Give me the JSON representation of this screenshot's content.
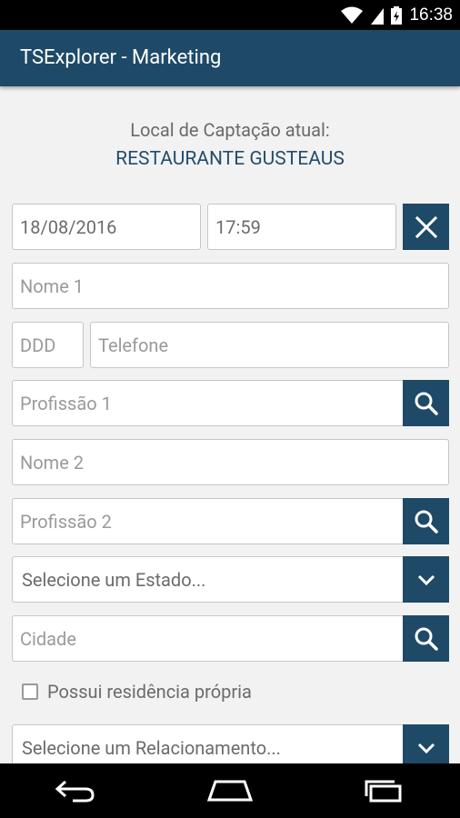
{
  "status_bar": {
    "time": "16:38"
  },
  "app_bar": {
    "title": "TSExplorer - Marketing"
  },
  "location": {
    "label": "Local de Captação atual:",
    "value": "RESTAURANTE GUSTEAUS"
  },
  "form": {
    "date": "18/08/2016",
    "time": "17:59",
    "nome1_placeholder": "Nome 1",
    "ddd_placeholder": "DDD",
    "telefone_placeholder": "Telefone",
    "profissao1_placeholder": "Profissão 1",
    "nome2_placeholder": "Nome 2",
    "profissao2_placeholder": "Profissão 2",
    "estado_select": "Selecione um Estado...",
    "cidade_placeholder": "Cidade",
    "residencia_checkbox": "Possui residência própria",
    "relacionamento_select": "Selecione um Relacionamento..."
  },
  "colors": {
    "primary": "#1e4a68",
    "accent_text": "#234d6d"
  }
}
